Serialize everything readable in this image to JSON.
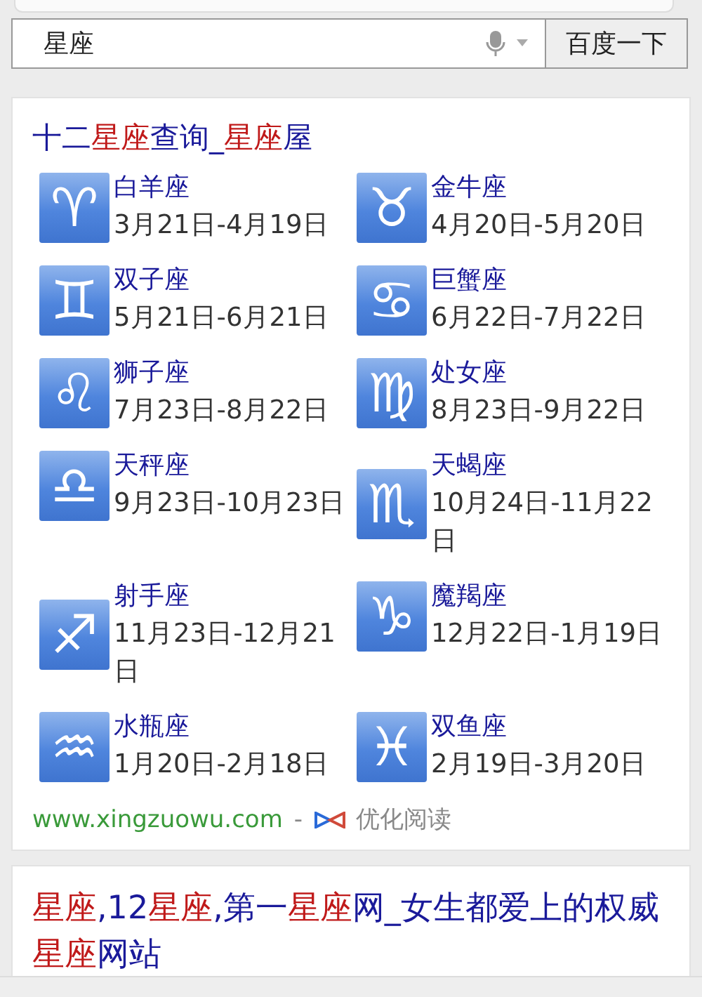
{
  "search": {
    "value": "星座",
    "button": "百度一下"
  },
  "result": {
    "title": [
      {
        "text": "十二",
        "highlight": false
      },
      {
        "text": "星座",
        "highlight": true
      },
      {
        "text": "查询_",
        "highlight": false
      },
      {
        "text": "星座",
        "highlight": true
      },
      {
        "text": "屋",
        "highlight": false
      }
    ],
    "signs": [
      {
        "symbol": "♈",
        "name": "白羊座",
        "dates": "3月21日-4月19日"
      },
      {
        "symbol": "♉",
        "name": "金牛座",
        "dates": "4月20日-5月20日"
      },
      {
        "symbol": "♊",
        "name": "双子座",
        "dates": "5月21日-6月21日"
      },
      {
        "symbol": "♋",
        "name": "巨蟹座",
        "dates": "6月22日-7月22日"
      },
      {
        "symbol": "♌",
        "name": "狮子座",
        "dates": "7月23日-8月22日"
      },
      {
        "symbol": "♍",
        "name": "处女座",
        "dates": "8月23日-9月22日"
      },
      {
        "symbol": "♎",
        "name": "天秤座",
        "dates": "9月23日-10月23日"
      },
      {
        "symbol": "♏",
        "name": "天蝎座",
        "dates": "10月24日-11月22日"
      },
      {
        "symbol": "♐",
        "name": "射手座",
        "dates": "11月23日-12月21日"
      },
      {
        "symbol": "♑",
        "name": "魔羯座",
        "dates": "12月22日-1月19日"
      },
      {
        "symbol": "♒",
        "name": "水瓶座",
        "dates": "1月20日-2月18日"
      },
      {
        "symbol": "♓",
        "name": "双鱼座",
        "dates": "2月19日-3月20日"
      }
    ],
    "url": "www.xingzuowu.com",
    "separator": "-",
    "reader": "优化阅读"
  },
  "result_2": {
    "title": [
      {
        "text": "星座",
        "highlight": true
      },
      {
        "text": ",12",
        "highlight": false
      },
      {
        "text": "星座",
        "highlight": true
      },
      {
        "text": ",第一",
        "highlight": false
      },
      {
        "text": "星座",
        "highlight": true
      },
      {
        "text": "网_女生都爱上的权威",
        "highlight": false
      },
      {
        "text": "星座",
        "highlight": true
      },
      {
        "text": "网站",
        "highlight": false
      }
    ]
  }
}
